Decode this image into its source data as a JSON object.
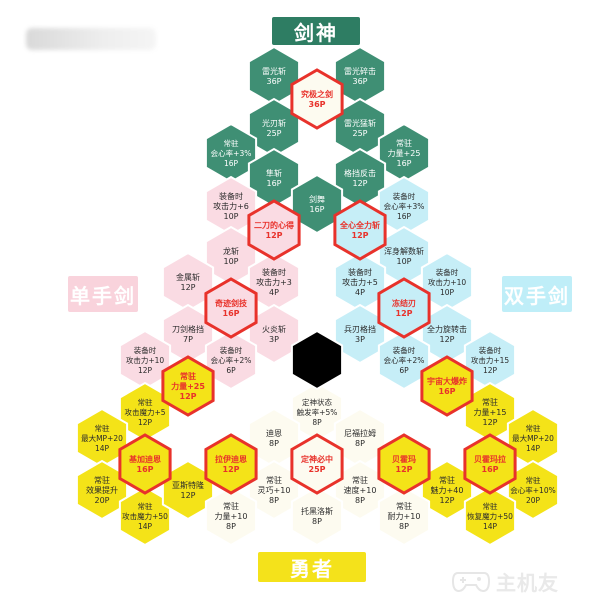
{
  "titles": {
    "top": "剑神",
    "left": "单手剑",
    "right": "双手剑",
    "bottom": "勇者"
  },
  "watermark": "主机友",
  "colors": {
    "green": "#3f8f74",
    "pink": "#fadbe3",
    "blue": "#c6eef7",
    "white": "#fdfbf0",
    "yellow": "#f4e318",
    "center": "#000000",
    "highlight": "#e8322b",
    "stroke": "#ffffff",
    "title_green": "#2e7d63",
    "title_yellow": "#f4e21b"
  },
  "nodes": [
    {
      "id": "green-1",
      "lines": [
        "雷光斩",
        "36P"
      ],
      "color": "green"
    },
    {
      "id": "green-2",
      "lines": [
        "雷光碎击",
        "36P"
      ],
      "color": "green"
    },
    {
      "id": "green-3",
      "lines": [
        "究极之剑",
        "36P"
      ],
      "color": "white",
      "highlight": true
    },
    {
      "id": "green-4",
      "lines": [
        "光刃斩",
        "25P"
      ],
      "color": "green"
    },
    {
      "id": "green-5",
      "lines": [
        "雷光猛斩",
        "25P"
      ],
      "color": "green"
    },
    {
      "id": "green-6",
      "lines": [
        "常驻",
        "会心率+3%",
        "16P"
      ],
      "color": "green"
    },
    {
      "id": "green-7",
      "lines": [
        "常驻",
        "力量+25",
        "16P"
      ],
      "color": "green"
    },
    {
      "id": "green-8",
      "lines": [
        "隼斩",
        "16P"
      ],
      "color": "green"
    },
    {
      "id": "green-9",
      "lines": [
        "格挡反击",
        "12P"
      ],
      "color": "green"
    },
    {
      "id": "green-10",
      "lines": [
        "剑舞",
        "16P"
      ],
      "color": "green"
    },
    {
      "id": "pink-1",
      "lines": [
        "装备时",
        "攻击力+6",
        "10P"
      ],
      "color": "pink"
    },
    {
      "id": "pink-2",
      "lines": [
        "二刀的心得",
        "12P"
      ],
      "color": "pink",
      "highlight": true
    },
    {
      "id": "pink-3",
      "lines": [
        "龙斩",
        "10P"
      ],
      "color": "pink"
    },
    {
      "id": "pink-4",
      "lines": [
        "金属斩",
        "12P"
      ],
      "color": "pink"
    },
    {
      "id": "pink-5",
      "lines": [
        "装备时",
        "攻击力+3",
        "4P"
      ],
      "color": "pink"
    },
    {
      "id": "pink-6",
      "lines": [
        "奇迹剑技",
        "16P"
      ],
      "color": "pink",
      "highlight": true
    },
    {
      "id": "pink-7",
      "lines": [
        "刀剑格挡",
        "7P"
      ],
      "color": "pink"
    },
    {
      "id": "pink-8",
      "lines": [
        "火炎斩",
        "3P"
      ],
      "color": "pink"
    },
    {
      "id": "pink-9",
      "lines": [
        "装备时",
        "攻击力+10",
        "12P"
      ],
      "color": "pink"
    },
    {
      "id": "pink-10",
      "lines": [
        "装备时",
        "会心率+2%",
        "6P"
      ],
      "color": "pink"
    },
    {
      "id": "blue-1",
      "lines": [
        "全心全力斩",
        "12P"
      ],
      "color": "blue",
      "highlight": true
    },
    {
      "id": "blue-2",
      "lines": [
        "装备时",
        "会心率+3%",
        "16P"
      ],
      "color": "blue"
    },
    {
      "id": "blue-3",
      "lines": [
        "浑身解数斩",
        "10P"
      ],
      "color": "blue"
    },
    {
      "id": "blue-4",
      "lines": [
        "装备时",
        "攻击力+5",
        "4P"
      ],
      "color": "blue"
    },
    {
      "id": "blue-5",
      "lines": [
        "装备时",
        "攻击力+10",
        "10P"
      ],
      "color": "blue"
    },
    {
      "id": "blue-6",
      "lines": [
        "冻结刃",
        "12P"
      ],
      "color": "blue",
      "highlight": true
    },
    {
      "id": "blue-7",
      "lines": [
        "兵刃格挡",
        "3P"
      ],
      "color": "blue"
    },
    {
      "id": "blue-8",
      "lines": [
        "全力旋转击",
        "12P"
      ],
      "color": "blue"
    },
    {
      "id": "blue-9",
      "lines": [
        "装备时",
        "会心率+2%",
        "6P"
      ],
      "color": "blue"
    },
    {
      "id": "blue-10",
      "lines": [
        "装备时",
        "攻击力+15",
        "12P"
      ],
      "color": "blue"
    },
    {
      "id": "yel-1",
      "lines": [
        "常驻",
        "力量+25",
        "12P"
      ],
      "color": "yellow",
      "highlight": true
    },
    {
      "id": "yel-2",
      "lines": [
        "常驻",
        "攻击魔力+5",
        "12P"
      ],
      "color": "yellow"
    },
    {
      "id": "yel-3",
      "lines": [
        "常驻",
        "最大MP+20",
        "14P"
      ],
      "color": "yellow"
    },
    {
      "id": "yel-4",
      "lines": [
        "基加迪恩",
        "16P"
      ],
      "color": "yellow",
      "highlight": true
    },
    {
      "id": "yel-5",
      "lines": [
        "常驻",
        "效果提升",
        "20P"
      ],
      "color": "yellow"
    },
    {
      "id": "yel-6",
      "lines": [
        "常驻",
        "攻击魔力+50",
        "14P"
      ],
      "color": "yellow"
    },
    {
      "id": "yel-7",
      "lines": [
        "亚斯特隆",
        "12P"
      ],
      "color": "yellow"
    },
    {
      "id": "yel-8",
      "lines": [
        "拉伊迪恩",
        "12P"
      ],
      "color": "yellow",
      "highlight": true
    },
    {
      "id": "yel-9",
      "lines": [
        "宇宙大爆炸",
        "16P"
      ],
      "color": "yellow",
      "highlight": true
    },
    {
      "id": "yel-10",
      "lines": [
        "常驻",
        "力量+15",
        "12P"
      ],
      "color": "yellow"
    },
    {
      "id": "yel-11",
      "lines": [
        "常驻",
        "最大MP+20",
        "14P"
      ],
      "color": "yellow"
    },
    {
      "id": "yel-12",
      "lines": [
        "贝霍玛",
        "12P"
      ],
      "color": "yellow",
      "highlight": true
    },
    {
      "id": "yel-13",
      "lines": [
        "贝霍玛拉",
        "16P"
      ],
      "color": "yellow",
      "highlight": true
    },
    {
      "id": "yel-14",
      "lines": [
        "常驻",
        "魅力+40",
        "12P"
      ],
      "color": "yellow"
    },
    {
      "id": "yel-15",
      "lines": [
        "常驻",
        "会心率+10%",
        "20P"
      ],
      "color": "yellow"
    },
    {
      "id": "yel-16",
      "lines": [
        "常驻",
        "恢复魔力+50",
        "14P"
      ],
      "color": "yellow"
    },
    {
      "id": "wht-1",
      "lines": [
        "定神状态",
        "触发率+5%",
        "8P"
      ],
      "color": "white"
    },
    {
      "id": "wht-2",
      "lines": [
        "迪恩",
        "8P"
      ],
      "color": "white"
    },
    {
      "id": "wht-3",
      "lines": [
        "尼福拉姆",
        "8P"
      ],
      "color": "white"
    },
    {
      "id": "wht-4",
      "lines": [
        "定神必中",
        "25P"
      ],
      "color": "white",
      "highlight": true
    },
    {
      "id": "wht-5",
      "lines": [
        "常驻",
        "灵巧+10",
        "8P"
      ],
      "color": "white"
    },
    {
      "id": "wht-6",
      "lines": [
        "常驻",
        "速度+10",
        "8P"
      ],
      "color": "white"
    },
    {
      "id": "wht-7",
      "lines": [
        "常驻",
        "力量+10",
        "8P"
      ],
      "color": "white"
    },
    {
      "id": "wht-8",
      "lines": [
        "托黑洛斯",
        "8P"
      ],
      "color": "white"
    },
    {
      "id": "wht-9",
      "lines": [
        "常驻",
        "耐力+10",
        "8P"
      ],
      "color": "white"
    },
    {
      "id": "center",
      "lines": [],
      "color": "center"
    }
  ]
}
